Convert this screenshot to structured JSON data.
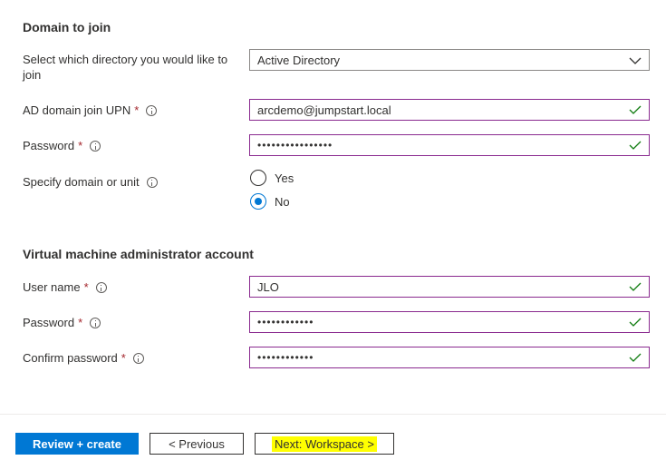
{
  "domain_section": {
    "title": "Domain to join",
    "directory_label": "Select which directory you would like to join",
    "directory_value": "Active Directory",
    "upn_label": "AD domain join UPN",
    "upn_value": "arcdemo@jumpstart.local",
    "password_label": "Password",
    "password_value": "••••••••••••••••",
    "unit_label": "Specify domain or unit",
    "unit_options": [
      "Yes",
      "No"
    ],
    "unit_selected": "No"
  },
  "vm_section": {
    "title": "Virtual machine administrator account",
    "username_label": "User name",
    "username_value": "JLO",
    "password_label": "Password",
    "password_value": "••••••••••••",
    "confirm_label": "Confirm password",
    "confirm_value": "••••••••••••"
  },
  "required_mark": "*",
  "footer": {
    "review_label": "Review + create",
    "previous_label": "< Previous",
    "next_label": "Next: Workspace >"
  },
  "colors": {
    "primary": "#0078d4",
    "valid_check": "#107c10",
    "input_border": "#8a2a8f",
    "required": "#a4262c",
    "highlight": "#ffff00"
  }
}
